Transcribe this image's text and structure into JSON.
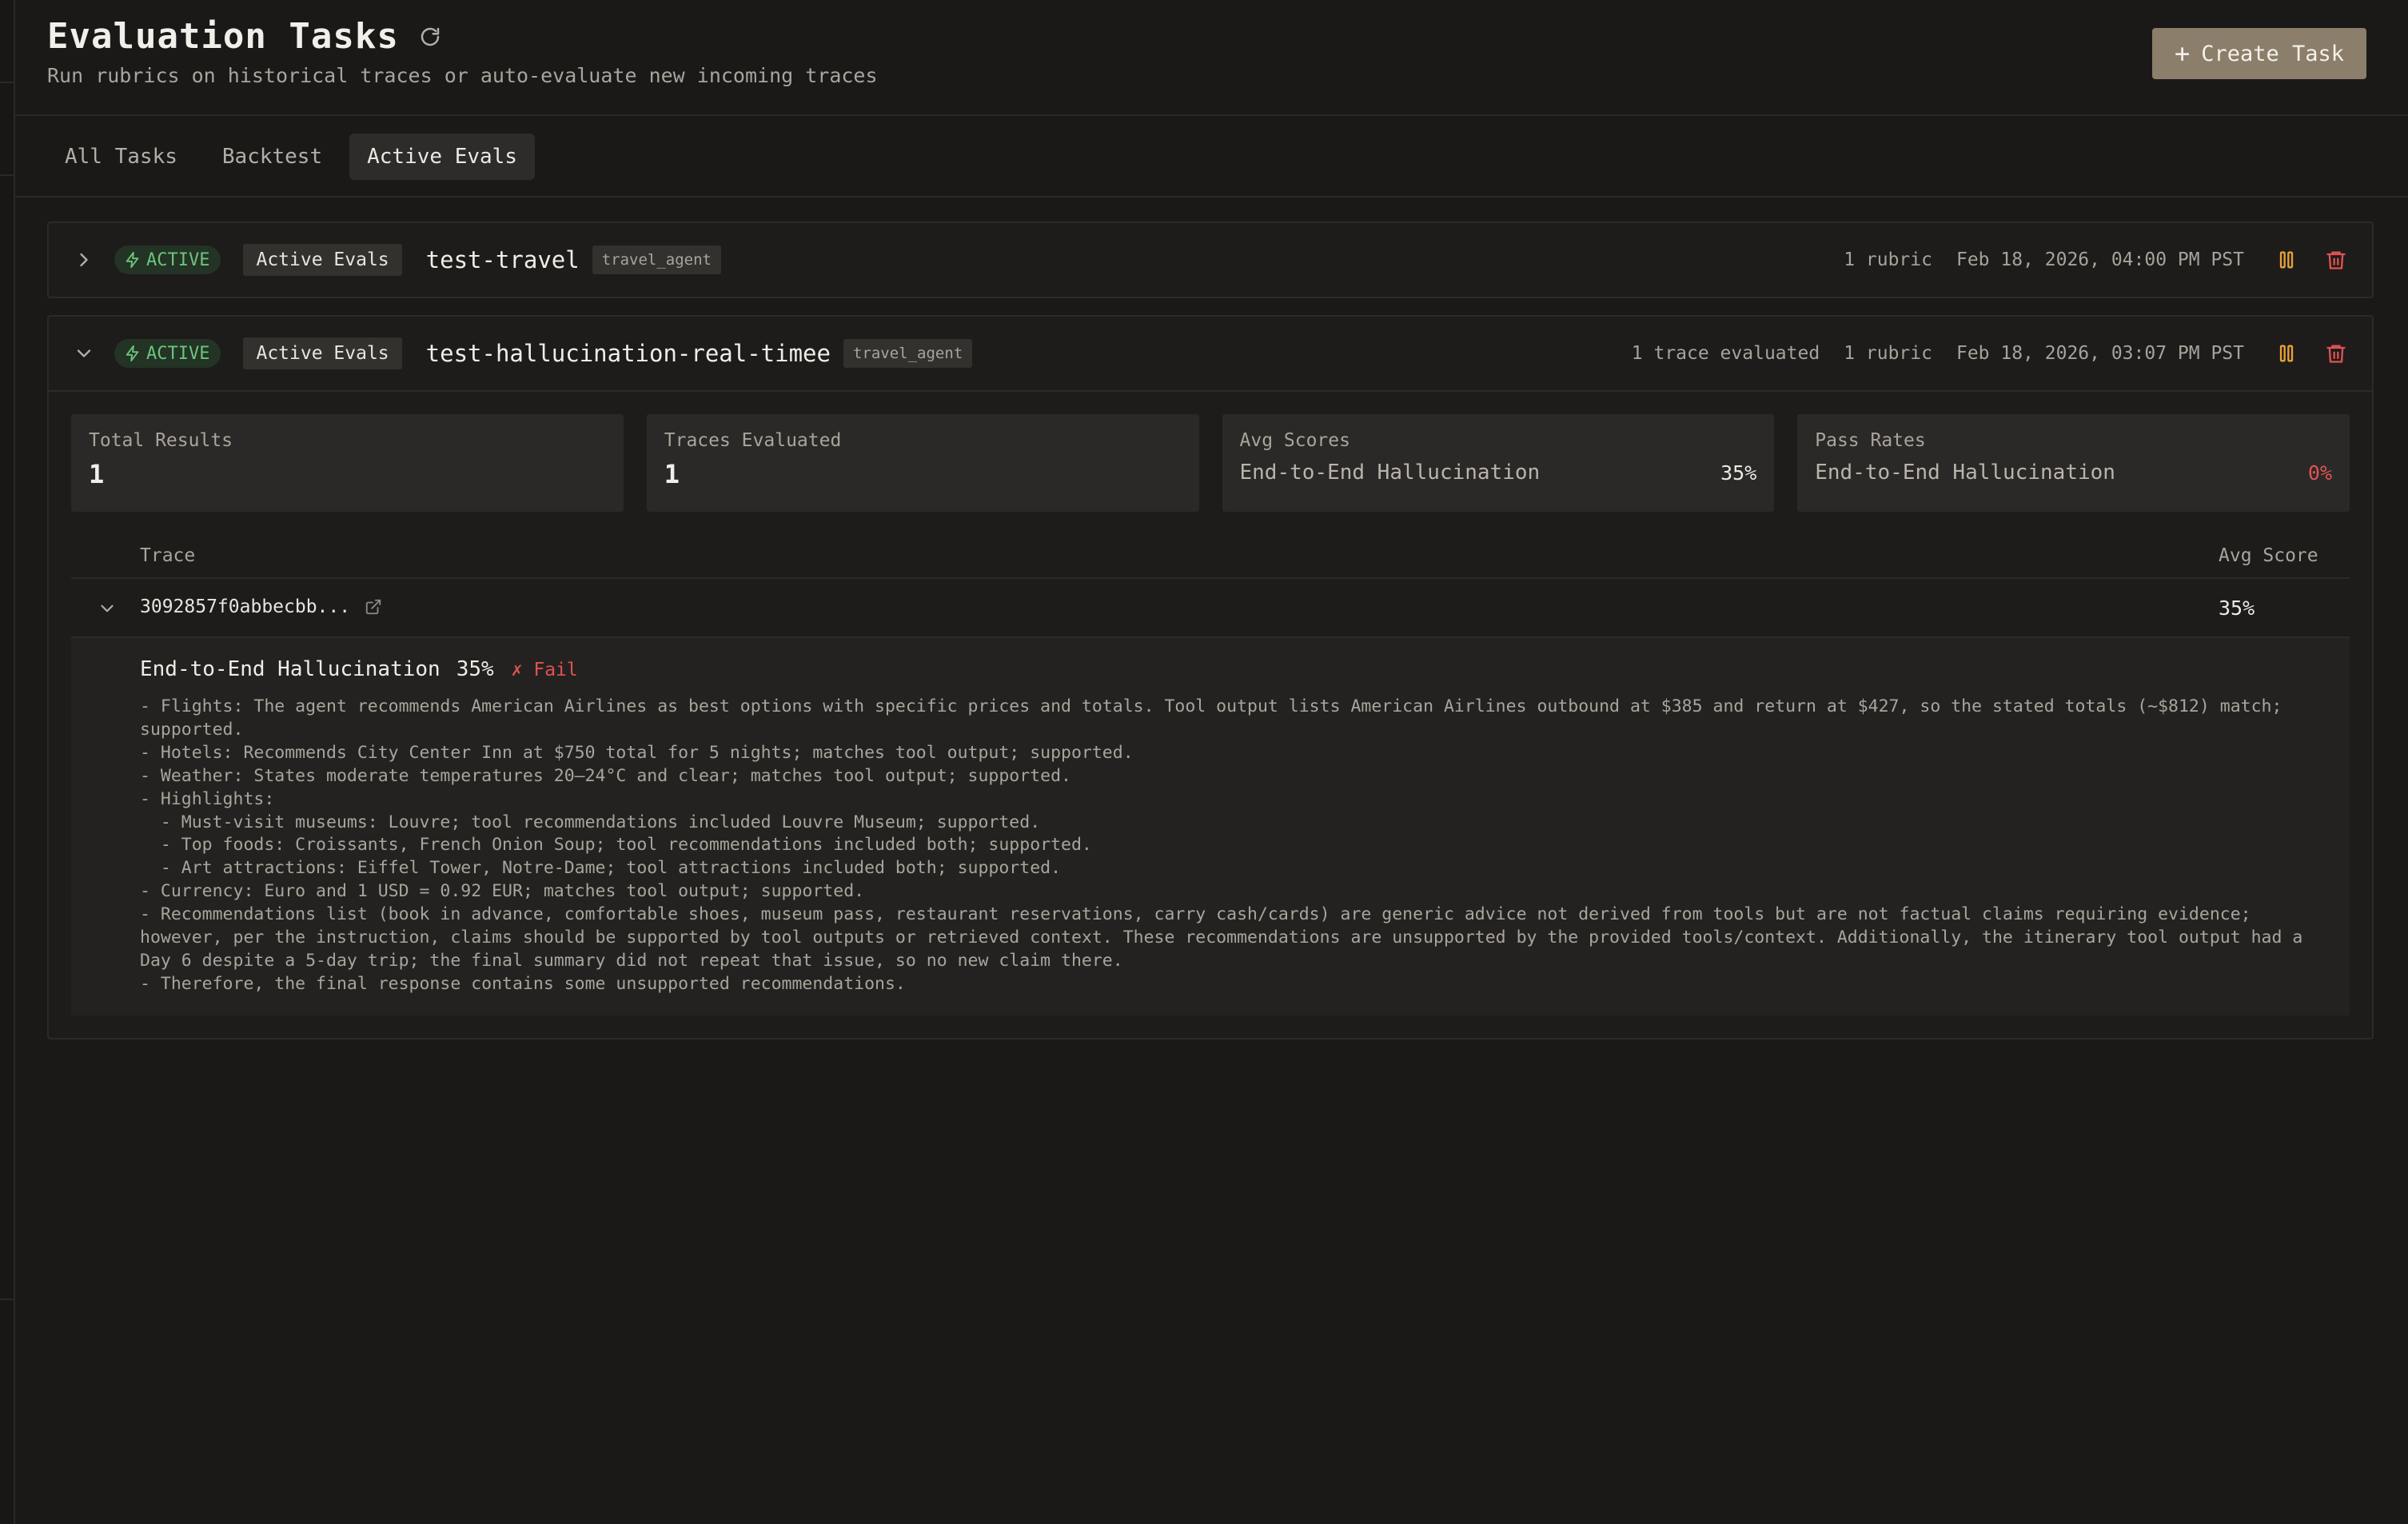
{
  "header": {
    "title": "Evaluation Tasks",
    "subtitle": "Run rubrics on historical traces or auto-evaluate new incoming traces",
    "create_label": "Create Task"
  },
  "tabs": [
    {
      "label": "All Tasks",
      "active": false
    },
    {
      "label": "Backtest",
      "active": false
    },
    {
      "label": "Active Evals",
      "active": true
    }
  ],
  "tasks": [
    {
      "status": "ACTIVE",
      "type": "Active Evals",
      "name": "test-travel",
      "agent": "travel_agent",
      "rubrics": "1 rubric",
      "date": "Feb 18, 2026, 04:00 PM PST",
      "expanded": false
    },
    {
      "status": "ACTIVE",
      "type": "Active Evals",
      "name": "test-hallucination-real-timee",
      "agent": "travel_agent",
      "traces": "1 trace evaluated",
      "rubrics": "1 rubric",
      "date": "Feb 18, 2026, 03:07 PM PST",
      "expanded": true,
      "stats": {
        "total_results_label": "Total Results",
        "total_results": "1",
        "traces_evaluated_label": "Traces Evaluated",
        "traces_evaluated": "1",
        "avg_scores_label": "Avg Scores",
        "avg_scores_name": "End-to-End Hallucination",
        "avg_scores_value": "35%",
        "pass_rates_label": "Pass Rates",
        "pass_rates_name": "End-to-End Hallucination",
        "pass_rates_value": "0%"
      },
      "table": {
        "col_trace": "Trace",
        "col_score": "Avg Score",
        "rows": [
          {
            "trace_id": "3092857f0abbecbb...",
            "score": "35%",
            "rubric": "End-to-End Hallucination",
            "rubric_score": "35%",
            "verdict": "✗ Fail",
            "reasoning": "- Flights: The agent recommends American Airlines as best options with specific prices and totals. Tool output lists American Airlines outbound at $385 and return at $427, so the stated totals (~$812) match;\nsupported.\n- Hotels: Recommends City Center Inn at $750 total for 5 nights; matches tool output; supported.\n- Weather: States moderate temperatures 20–24°C and clear; matches tool output; supported.\n- Highlights:\n  - Must-visit museums: Louvre; tool recommendations included Louvre Museum; supported.\n  - Top foods: Croissants, French Onion Soup; tool recommendations included both; supported.\n  - Art attractions: Eiffel Tower, Notre-Dame; tool attractions included both; supported.\n- Currency: Euro and 1 USD = 0.92 EUR; matches tool output; supported.\n- Recommendations list (book in advance, comfortable shoes, museum pass, restaurant reservations, carry cash/cards) are generic advice not derived from tools but are not factual claims requiring evidence;\nhowever, per the instruction, claims should be supported by tool outputs or retrieved context. These recommendations are unsupported by the provided tools/context. Additionally, the itinerary tool output had a\nDay 6 despite a 5-day trip; the final summary did not repeat that issue, so no new claim there.\n- Therefore, the final response contains some unsupported recommendations."
          }
        ]
      }
    }
  ],
  "colors": {
    "background": "#1a1918",
    "accent_button": "#8b7e6b",
    "active_green": "#6cc47a",
    "fail_red": "#e05252",
    "pause_orange": "#e8a13a",
    "delete_red": "#e05252"
  },
  "icons": {
    "refresh": "refresh-icon",
    "plus": "plus-icon",
    "expand": "chevron-right-icon",
    "collapse": "chevron-down-icon",
    "status": "lightning-icon",
    "pause": "pause-icon",
    "delete": "trash-icon",
    "external": "external-link-icon"
  }
}
